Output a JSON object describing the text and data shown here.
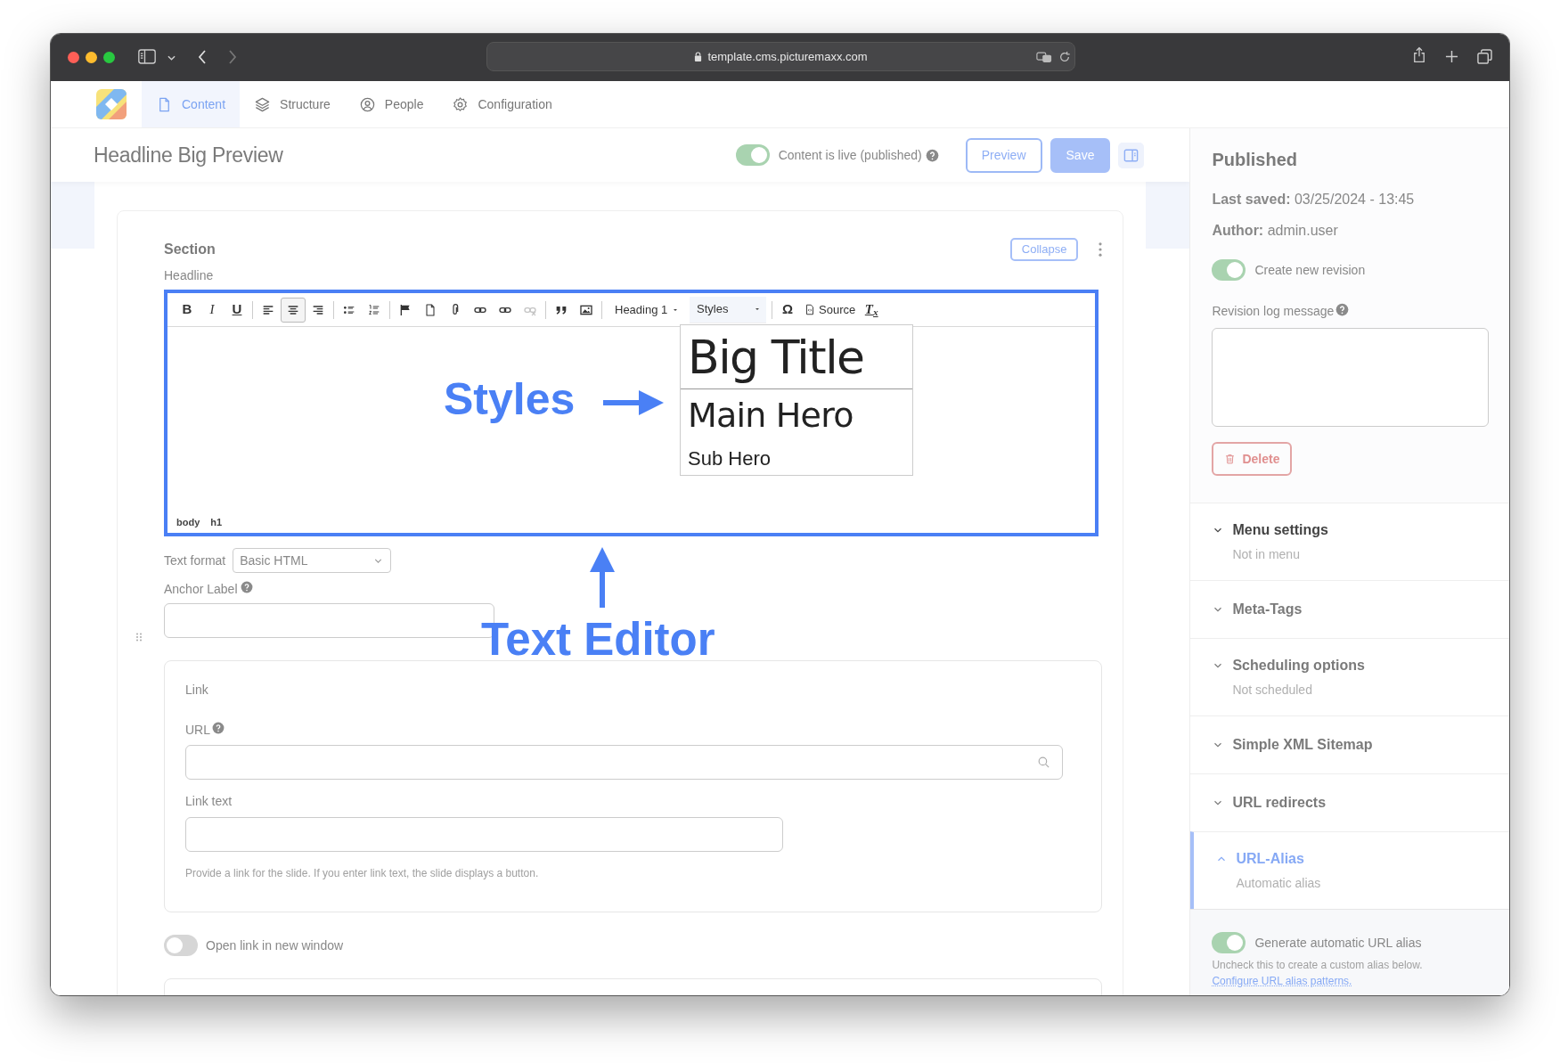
{
  "browser": {
    "url": "template.cms.picturemaxx.com"
  },
  "nav": {
    "tabs": [
      {
        "label": "Content",
        "selected": true
      },
      {
        "label": "Structure",
        "selected": false
      },
      {
        "label": "People",
        "selected": false
      },
      {
        "label": "Configuration",
        "selected": false
      }
    ]
  },
  "header": {
    "title": "Headline Big Preview",
    "live_toggle": {
      "label": "Content is live (published)",
      "on": true
    },
    "buttons": [
      {
        "label": "Preview",
        "kind": "outline"
      },
      {
        "label": "Save",
        "kind": "primary"
      }
    ]
  },
  "section": {
    "title": "Section",
    "collapse_button": "Collapse",
    "field_label": "Headline",
    "editor": {
      "toolbar": [
        {
          "kind": "bold",
          "label": "B",
          "selected": false,
          "disabled": false
        },
        {
          "kind": "italic",
          "label": "I",
          "selected": false,
          "disabled": false
        },
        {
          "kind": "underline",
          "label": "U",
          "selected": false,
          "disabled": false
        },
        {
          "kind": "separator"
        },
        {
          "kind": "align-left",
          "selected": false,
          "disabled": false
        },
        {
          "kind": "align-center",
          "selected": true,
          "disabled": false
        },
        {
          "kind": "align-right",
          "selected": false,
          "disabled": false
        },
        {
          "kind": "separator"
        },
        {
          "kind": "bullet-list",
          "selected": false,
          "disabled": false
        },
        {
          "kind": "numbered-list",
          "selected": false,
          "disabled": false
        },
        {
          "kind": "separator"
        },
        {
          "kind": "flag",
          "selected": false,
          "disabled": false
        },
        {
          "kind": "document",
          "selected": false,
          "disabled": false
        },
        {
          "kind": "paperclip",
          "selected": false,
          "disabled": false
        },
        {
          "kind": "link",
          "selected": false,
          "disabled": false
        },
        {
          "kind": "link",
          "selected": false,
          "disabled": false
        },
        {
          "kind": "unlink",
          "selected": false,
          "disabled": true
        },
        {
          "kind": "separator"
        },
        {
          "kind": "quote",
          "selected": false,
          "disabled": false
        },
        {
          "kind": "image",
          "selected": false,
          "disabled": false
        },
        {
          "kind": "separator"
        },
        {
          "kind": "dropdown",
          "label": "Heading 1",
          "expanded": false
        },
        {
          "kind": "dropdown",
          "label": "Styles",
          "expanded": true
        },
        {
          "kind": "separator"
        },
        {
          "kind": "special-char",
          "label": "Ω",
          "selected": false,
          "disabled": false
        },
        {
          "kind": "source",
          "label": "Source"
        },
        {
          "kind": "clear-format",
          "label": "T$_{x}$",
          "selected": false,
          "disabled": false
        }
      ],
      "styles_menu": [
        {
          "label": "Big Title",
          "kind": "big-title"
        },
        {
          "label": "Main Hero",
          "kind": "main-hero"
        },
        {
          "label": "Sub Hero",
          "kind": "sub-hero"
        }
      ],
      "path": [
        "body",
        "h1"
      ]
    },
    "text_format": {
      "label": "Text format",
      "value": "Basic HTML"
    },
    "anchor_label": {
      "label": "Anchor Label"
    },
    "link": {
      "title": "Link",
      "url_label": "URL",
      "link_text_label": "Link text",
      "help": "Provide a link for the slide. If you enter link text, the slide displays a button."
    },
    "new_window_toggle": {
      "label": "Open link in new window",
      "on": false
    }
  },
  "annotations": [
    {
      "text": "Styles",
      "kind": "right-arrow"
    },
    {
      "text": "Text Editor",
      "kind": "up-arrow"
    }
  ],
  "sidebar": {
    "status": "Published",
    "last_saved": "**Last saved:** 03/25/2024 - 13:45",
    "author": "**Author:** admin.user",
    "revision_toggle": {
      "label": "Create new revision",
      "on": true
    },
    "revision_log": {
      "label": "Revision log message"
    },
    "delete_button": "Delete",
    "sections": [
      {
        "title": "Menu settings",
        "summary": "Not in menu",
        "expanded": false,
        "hovered": true
      },
      {
        "title": "Meta-Tags",
        "expanded": false,
        "hovered": false
      },
      {
        "title": "Scheduling options",
        "summary": "Not scheduled",
        "expanded": false,
        "hovered": false
      },
      {
        "title": "Simple XML Sitemap",
        "expanded": false,
        "hovered": false
      },
      {
        "title": "URL redirects",
        "expanded": false,
        "hovered": false
      },
      {
        "title": "URL-Alias",
        "summary": "Automatic alias",
        "expanded": true,
        "hovered": false
      }
    ],
    "alias_toggle": {
      "label": "Generate automatic URL alias",
      "on": true
    },
    "alias_help": "Uncheck this to create a custom alias below.",
    "alias_link": "Configure URL alias patterns."
  }
}
